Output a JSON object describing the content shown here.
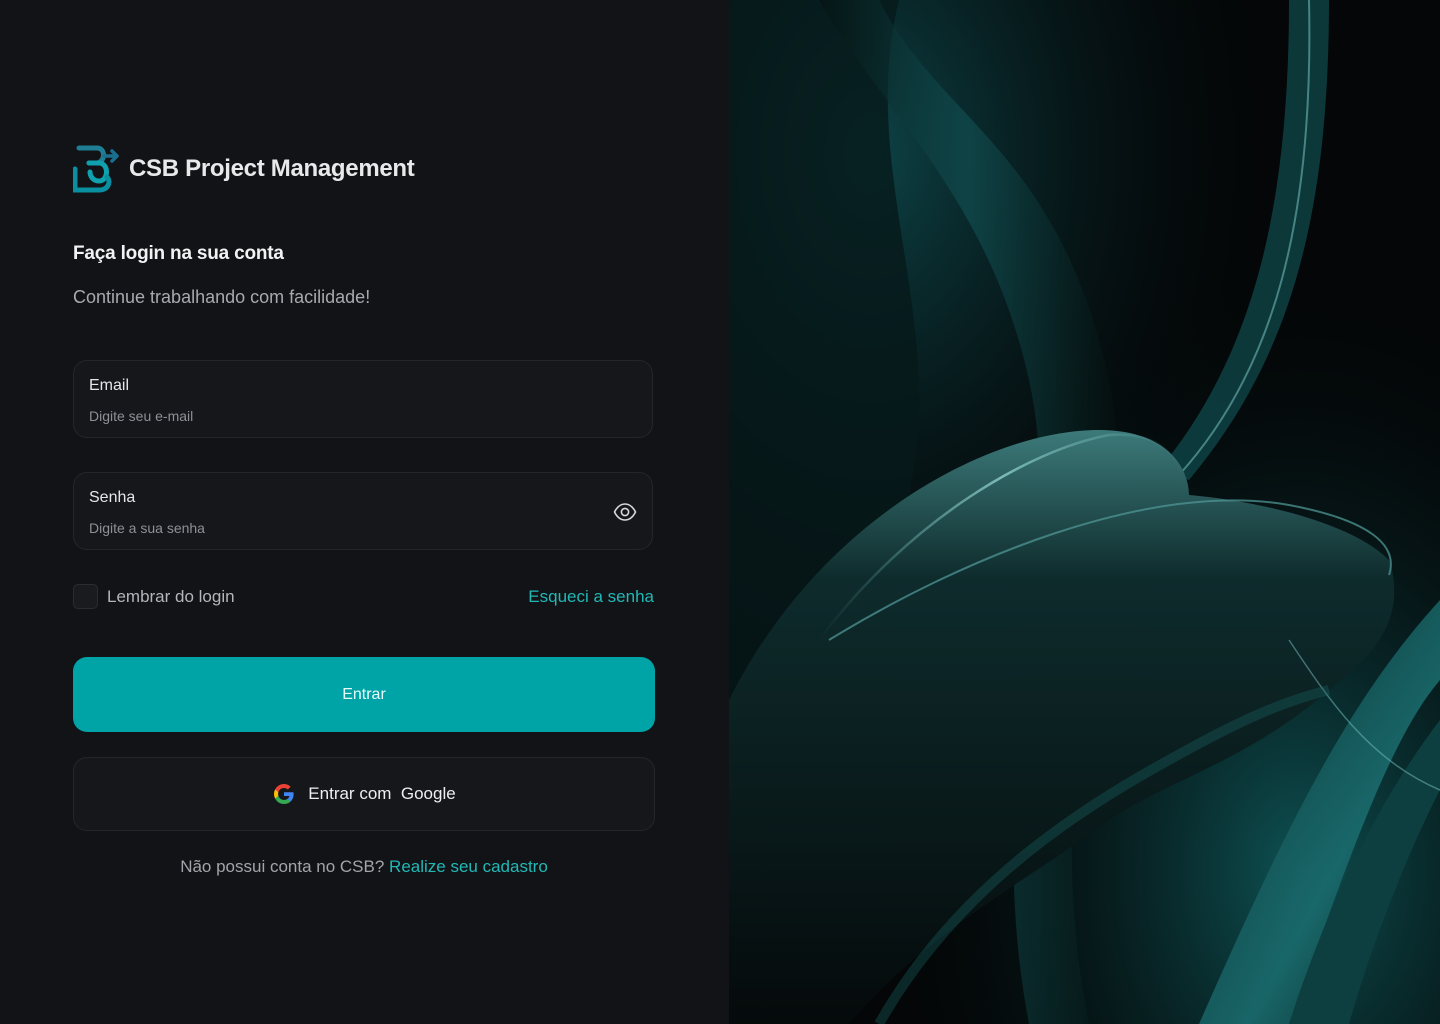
{
  "brand": {
    "name": "CSB Project Management",
    "logo_icon": "csb-logo-icon"
  },
  "login": {
    "heading": "Faça login na sua conta",
    "subheading": "Continue trabalhando com facilidade!"
  },
  "form": {
    "email": {
      "label": "Email",
      "placeholder": "Digite seu e-mail",
      "value": ""
    },
    "password": {
      "label": "Senha",
      "placeholder": "Digite a sua senha",
      "value": "",
      "toggle_icon": "eye-icon"
    },
    "remember_label": "Lembrar do login",
    "remember_checked": false,
    "forgot_link": "Esqueci a senha",
    "submit_label": "Entrar",
    "google_label": "Entrar com  Google",
    "google_icon": "google-icon"
  },
  "signup": {
    "prompt": "Não possui conta no CSB?",
    "link": "Realize seu cadastro"
  },
  "colors": {
    "background": "#121316",
    "accent": "#00a3a6",
    "link": "#21b8b6",
    "field_bg": "#16171b"
  }
}
